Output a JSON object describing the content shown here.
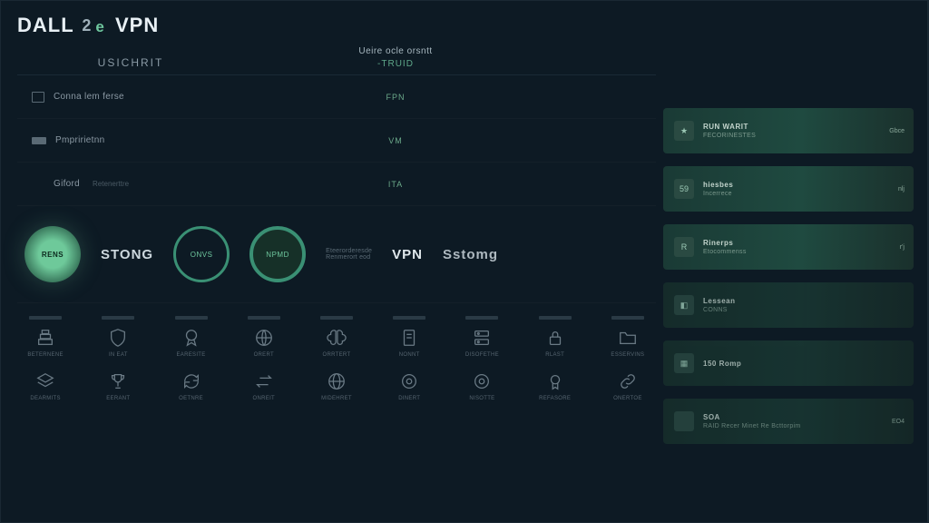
{
  "brand": {
    "d": "DALL",
    "two": "2",
    "e": "e",
    "vpn": "VPN"
  },
  "header": {
    "tab_left": "USICHRIT",
    "center_title": "Ueire ocle orsntt",
    "center_sub": "-TRUID"
  },
  "rows": [
    {
      "icon": "doc",
      "label": "Conna lem ferse",
      "sub": "",
      "mid": "FPN"
    },
    {
      "icon": "bar",
      "label": "Pmpririetnn",
      "sub": "",
      "mid": "VM"
    },
    {
      "icon": "",
      "label": "Giford",
      "sub": "Retenerttre",
      "mid": "ITA"
    }
  ],
  "circles": {
    "c1_label": "RENS",
    "big_label": "STONG",
    "c2_label": "ONVS",
    "c3_label": "NPMD",
    "desc_line1": "Eteerorderesde",
    "desc_line2": "Renmerort eod",
    "vpn": "VPN",
    "stomg": "Sstomg"
  },
  "grid": {
    "row1": [
      {
        "icon": "stack",
        "label": "BETERNENE"
      },
      {
        "icon": "shield",
        "label": "IN EAT"
      },
      {
        "icon": "badge",
        "label": "EARESITE"
      },
      {
        "icon": "globe-lines",
        "label": "ORERT"
      },
      {
        "icon": "brain",
        "label": "ORRTERT"
      },
      {
        "icon": "doc",
        "label": "NONNT"
      },
      {
        "icon": "server",
        "label": "DISOFETHE"
      },
      {
        "icon": "lock",
        "label": "RLAST"
      },
      {
        "icon": "folder",
        "label": "ESSERVINS"
      }
    ],
    "row2": [
      {
        "icon": "layers",
        "label": "DEARMITS"
      },
      {
        "icon": "trophy",
        "label": "EERANT"
      },
      {
        "icon": "refresh",
        "label": "OETNRE"
      },
      {
        "icon": "swap",
        "label": "ONREIT"
      },
      {
        "icon": "globe",
        "label": "MIDEHRET"
      },
      {
        "icon": "ring",
        "label": "DINERT"
      },
      {
        "icon": "ring",
        "label": "NISOTTE"
      },
      {
        "icon": "badge2",
        "label": "REFASORE"
      },
      {
        "icon": "link",
        "label": "ONERTOE"
      }
    ]
  },
  "side": [
    {
      "icon": "★",
      "title": "RUN WARIT",
      "sub": "FECORINESTES",
      "right": "Gbce"
    },
    {
      "icon": "59",
      "title": "hiesbes",
      "sub": "Incerrece",
      "right": "nlj"
    },
    {
      "icon": "R",
      "title": "Rinerps",
      "sub": "Etocommenss",
      "right": "r'j"
    },
    {
      "icon": "◧",
      "title": "Lessean",
      "sub": "CONNS",
      "right": ""
    },
    {
      "icon": "▦",
      "title": "150 Romp",
      "sub": "",
      "right": ""
    },
    {
      "icon": "",
      "title": "SOA",
      "sub": "RAID Recer   Minet Re Bcttorpim",
      "right": "EO4"
    }
  ]
}
